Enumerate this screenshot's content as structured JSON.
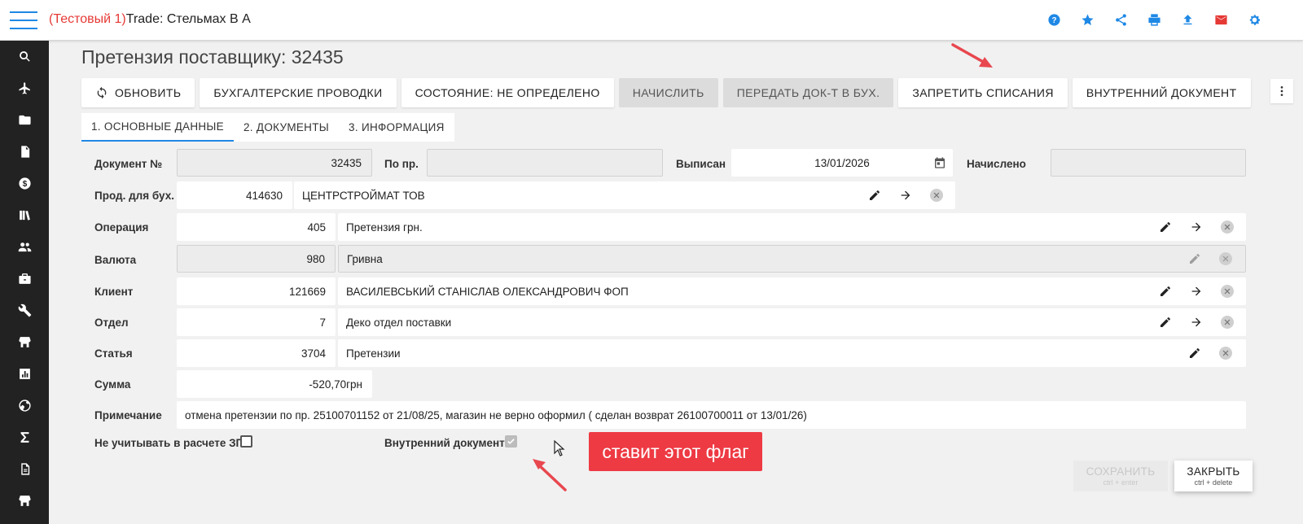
{
  "header": {
    "env_label": "(Тестовый 1)",
    "app_name": "Trade: Стельмах В А",
    "icons": [
      "help-icon",
      "star-icon",
      "share-icon",
      "print-icon",
      "upload-icon",
      "mail-icon",
      "settings-icon"
    ]
  },
  "sidebar": {
    "icons": [
      "search-icon",
      "airplane-icon",
      "folder-icon",
      "document-icon",
      "dollar-icon",
      "library-icon",
      "people-icon",
      "briefcase-icon",
      "wrench-icon",
      "store-icon",
      "chart-icon",
      "globe-icon",
      "sigma-icon",
      "file-icon",
      "store-icon-2"
    ]
  },
  "page": {
    "title": "Претензия поставщику: 32435"
  },
  "toolbar": {
    "refresh": "ОБНОВИТЬ",
    "entries": "БУХГАЛТЕРСКИЕ ПРОВОДКИ",
    "state": "СОСТОЯНИЕ: НЕ ОПРЕДЕЛЕНО",
    "charge": "НАЧИСЛИТЬ",
    "transfer": "ПЕРЕДАТЬ ДОК-Т В БУХ.",
    "forbid": "ЗАПРЕТИТЬ СПИСАНИЯ",
    "internal": "ВНУТРЕННИЙ ДОКУМЕНТ"
  },
  "tabs": [
    "1. ОСНОВНЫЕ ДАННЫЕ",
    "2. ДОКУМЕНТЫ",
    "3. ИНФОРМАЦИЯ"
  ],
  "form": {
    "doc_no_label": "Документ №",
    "doc_no": "32435",
    "po_pr_label": "По пр.",
    "po_pr": "",
    "issued_label": "Выписан",
    "issued": "13/01/2026",
    "accrued_label": "Начислено",
    "accrued": "",
    "seller_label": "Прод. для бух.",
    "seller_code": "414630",
    "seller_name": "ЦЕНТРСТРОЙМАТ ТОВ",
    "operation_label": "Операция",
    "operation_code": "405",
    "operation_name": "Претензия грн.",
    "currency_label": "Валюта",
    "currency_code": "980",
    "currency_name": "Гривна",
    "client_label": "Клиент",
    "client_code": "121669",
    "client_name": "ВАСИЛЕВСЬКИЙ СТАНІСЛАВ ОЛЕКСАНДРОВИЧ ФОП",
    "dept_label": "Отдел",
    "dept_code": "7",
    "dept_name": "Деко отдел поставки",
    "article_label": "Статья",
    "article_code": "3704",
    "article_name": "Претензии",
    "sum_label": "Сумма",
    "sum": "-520,70грн",
    "note_label": "Примечание",
    "note": "отмена претензии по пр. 25100701152 от 21/08/25, магазин не верно оформил ( сделан возврат 26100700011 от 13/01/26)",
    "exclude_zp_label": "Не учитывать в расчете ЗП",
    "exclude_zp": false,
    "internal_doc_label": "Внутренний документ",
    "internal_doc": true
  },
  "annotation": {
    "text": "ставит этот флаг",
    "color": "#ee3a43"
  },
  "footer": {
    "save": "СОХРАНИТЬ",
    "save_hint": "ctrl + enter",
    "close": "ЗАКРЫТЬ",
    "close_hint": "ctrl + delete"
  },
  "colors": {
    "accent": "#1e88e5",
    "sidebar": "#222222",
    "env_label": "#e53935",
    "mail_icon": "#e53935"
  }
}
